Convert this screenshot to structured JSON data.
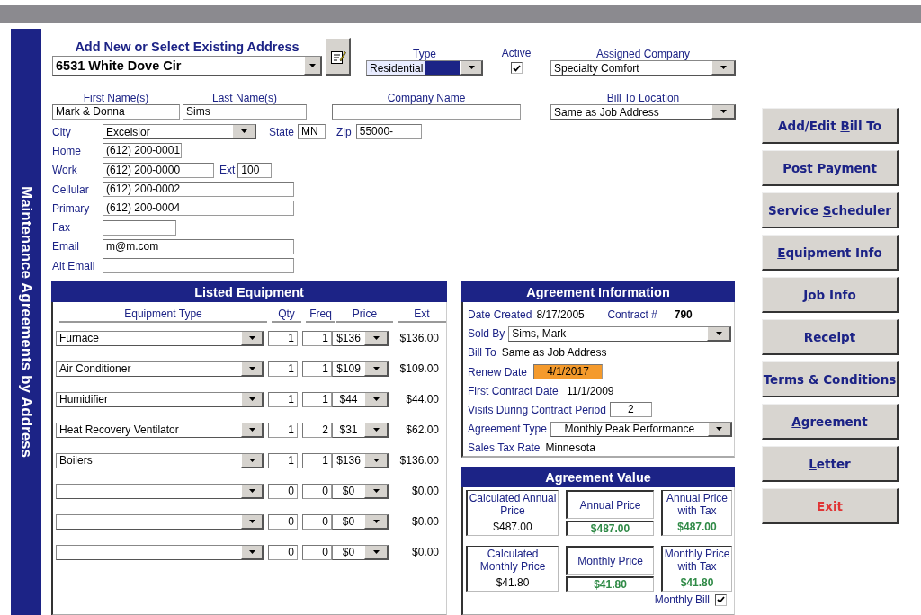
{
  "sidebar": {
    "title": "Maintenance Agreements by Address"
  },
  "address": {
    "heading": "Add New or Select Existing Address",
    "value": "6531 White Dove Cir"
  },
  "type": {
    "label": "Type",
    "value": "Residential",
    "focused": true
  },
  "active": {
    "label": "Active",
    "checked": true
  },
  "assigned_company": {
    "label": "Assigned Company",
    "value": "Specialty Comfort"
  },
  "first_name": {
    "label": "First Name(s)",
    "value": "Mark & Donna"
  },
  "last_name": {
    "label": "Last Name(s)",
    "value": "Sims"
  },
  "company_name": {
    "label": "Company Name"
  },
  "bill_to_location": {
    "label": "Bill To Location",
    "value": "Same as Job Address"
  },
  "city": {
    "label": "City",
    "value": "Excelsior"
  },
  "state": {
    "label": "State",
    "value": "MN"
  },
  "zip": {
    "label": "Zip",
    "value": "55000-"
  },
  "contacts": [
    {
      "label": "Home",
      "value": "(612) 200-0001"
    },
    {
      "label": "Work",
      "value": "(612) 200-0000",
      "ext": {
        "label": "Ext",
        "value": "100"
      }
    },
    {
      "label": "Cellular",
      "value": "(612) 200-0002"
    },
    {
      "label": "Primary",
      "value": "(612) 200-0004"
    },
    {
      "label": "Fax"
    },
    {
      "label": "Email",
      "value": "m@m.com"
    },
    {
      "label": "Alt Email"
    }
  ],
  "listed_equipment": {
    "title": "Listed Equipment",
    "columns": [
      "Equipment Type",
      "Qty",
      "Freq",
      "Price",
      "Ext"
    ],
    "rows": [
      {
        "type": "Furnace",
        "qty": "1",
        "freq": "1",
        "price": "$136",
        "ext": "$136.00"
      },
      {
        "type": "Air Conditioner",
        "qty": "1",
        "freq": "1",
        "price": "$109",
        "ext": "$109.00"
      },
      {
        "type": "Humidifier",
        "qty": "1",
        "freq": "1",
        "price": "$44",
        "ext": "$44.00"
      },
      {
        "type": "Heat Recovery Ventilator",
        "qty": "1",
        "freq": "2",
        "price": "$31",
        "ext": "$62.00"
      },
      {
        "type": "Boilers",
        "qty": "1",
        "freq": "1",
        "price": "$136",
        "ext": "$136.00"
      },
      {
        "qty": "0",
        "freq": "0",
        "price": "$0",
        "ext": "$0.00"
      },
      {
        "qty": "0",
        "freq": "0",
        "price": "$0",
        "ext": "$0.00"
      },
      {
        "qty": "0",
        "freq": "0",
        "price": "$0",
        "ext": "$0.00"
      }
    ]
  },
  "agreement_information": {
    "title": "Agreement Information",
    "date_created": {
      "label": "Date Created",
      "value": "8/17/2005"
    },
    "contract": {
      "label": "Contract #",
      "value": "790"
    },
    "sold_by": {
      "label": "Sold By",
      "value": "Sims, Mark"
    },
    "bill_to": {
      "label": "Bill To",
      "value": "Same as Job Address"
    },
    "renew_date": {
      "label": "Renew Date",
      "value": "4/1/2017",
      "highlighted": true
    },
    "first_contract_date": {
      "label": "First Contract Date",
      "value": "11/1/2009"
    },
    "visits": {
      "label": "Visits During Contract Period",
      "value": "2"
    },
    "agreement_type": {
      "label": "Agreement Type",
      "value": "Monthly Peak Performance"
    },
    "sales_tax_rate": {
      "label": "Sales Tax Rate",
      "value": "Minnesota"
    }
  },
  "agreement_value": {
    "title": "Agreement Value",
    "cells": [
      {
        "kind": "calculated",
        "label": "Calculated Annual Price",
        "value": "$487.00"
      },
      {
        "kind": "price",
        "label": "Annual Price",
        "value": "$487.00"
      },
      {
        "kind": "with_tax",
        "label": "Annual Price with Tax",
        "value": "$487.00"
      },
      {
        "kind": "calculated",
        "label": "Calculated Monthly Price",
        "value": "$41.80"
      },
      {
        "kind": "price",
        "label": "Monthly Price",
        "value": "$41.80"
      },
      {
        "kind": "with_tax",
        "label": "Monthly Price with Tax",
        "value": "$41.80"
      }
    ],
    "monthly_bill": {
      "label": "Monthly Bill",
      "checked": true
    }
  },
  "buttons": [
    {
      "kind": "action",
      "before": "Add/Edit ",
      "hotkey": "B",
      "after": "ill To"
    },
    {
      "kind": "action",
      "before": "Post ",
      "hotkey": "P",
      "after": "ayment"
    },
    {
      "kind": "action",
      "before": "Service ",
      "hotkey": "S",
      "after": "cheduler"
    },
    {
      "kind": "action",
      "hotkey": "E",
      "after": "quipment Info"
    },
    {
      "kind": "action",
      "hotkey": "J",
      "after": "ob Info"
    },
    {
      "kind": "action",
      "hotkey": "R",
      "after": "eceipt"
    },
    {
      "kind": "action",
      "before": "Terms & Conditions"
    },
    {
      "kind": "action",
      "hotkey": "A",
      "after": "greement"
    },
    {
      "kind": "action",
      "hotkey": "L",
      "after": "etter"
    },
    {
      "kind": "exit",
      "before": "E",
      "hotkey": "x",
      "after": "it"
    }
  ]
}
